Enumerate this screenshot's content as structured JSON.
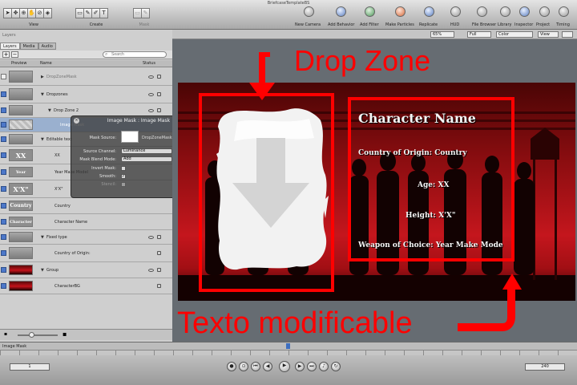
{
  "window": {
    "title": "BriefcaseTemplateBS"
  },
  "toolbar": {
    "view_label": "View",
    "create_label": "Create",
    "mask_label": "Mask",
    "right_items": [
      "New Camera",
      "Add Behavior",
      "Add Filter",
      "Make Particles",
      "Replicate",
      "HUD",
      "File Browser",
      "Library",
      "Inspector",
      "Project",
      "Timing"
    ]
  },
  "panel": {
    "title": "Layers",
    "tabs": [
      "Layers",
      "Media",
      "Audio"
    ],
    "search_placeholder": "Search",
    "col_preview": "Preview",
    "col_name": "Name",
    "col_status": "Status",
    "rows": [
      {
        "name": "DropZoneMask",
        "thumb": ""
      },
      {
        "name": "Dropzones",
        "thumb": ""
      },
      {
        "name": "Drop Zone 2",
        "thumb": ""
      },
      {
        "name": "Image Mask",
        "thumb": ""
      },
      {
        "name": "Editable text",
        "thumb": ""
      },
      {
        "name": "XX",
        "thumb": "XX"
      },
      {
        "name": "Year Make Model",
        "thumb": "Year Make"
      },
      {
        "name": "X'X\"",
        "thumb": "X'X\""
      },
      {
        "name": "Country",
        "thumb": "Country"
      },
      {
        "name": "Character Name",
        "thumb": "Character"
      },
      {
        "name": "Fixed type",
        "thumb": ""
      },
      {
        "name": "Country of Origin:",
        "thumb": ""
      },
      {
        "name": "Group",
        "thumb": ""
      },
      {
        "name": "CharacterBG",
        "thumb": ""
      }
    ]
  },
  "hud": {
    "title": "Image Mask : Image Mask",
    "mask_source_label": "Mask Source:",
    "mask_source_value": "DropZoneMask",
    "source_channel_label": "Source Channel:",
    "source_channel_value": "Luminance",
    "blend_mode_label": "Mask Blend Mode:",
    "blend_mode_value": "Add",
    "invert_label": "Invert Mask:",
    "invert_checked": false,
    "smooth_label": "Smooth:",
    "smooth_checked": true,
    "stencil_label": "Stencil:",
    "stencil_checked": false
  },
  "canvas": {
    "zoom": "65%",
    "resolution": "Full",
    "channel": "Color",
    "view": "View"
  },
  "scene": {
    "char_name": "Character Name",
    "country_line": "Country of Origin: Country",
    "age_line": "Age: XX",
    "height_line": "Height: X'X\"",
    "weapon_line": "Weapon of Choice: Year Make Mode"
  },
  "annotations": {
    "drop_zone": "Drop Zone",
    "texto": "Texto modificable",
    "color": "#ff0000"
  },
  "bottom": {
    "status_label": "Image Mask",
    "start_frame": "1",
    "end_frame": "240"
  }
}
